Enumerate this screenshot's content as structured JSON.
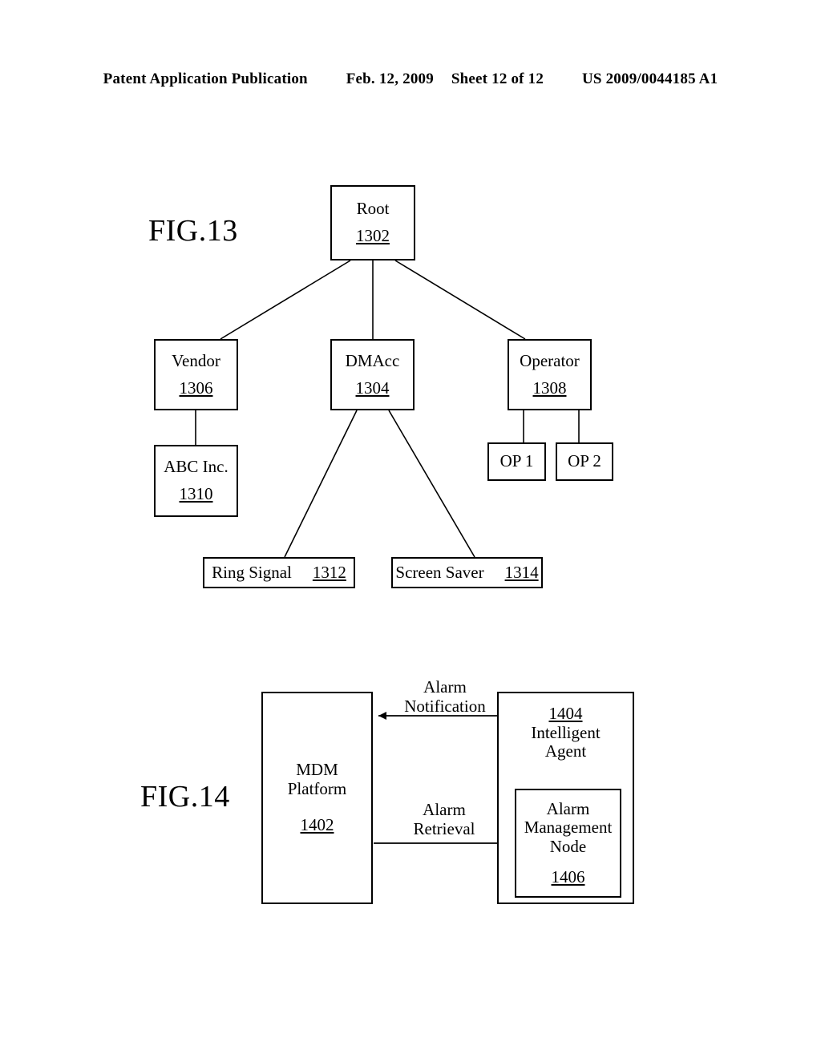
{
  "header": {
    "publication": "Patent Application Publication",
    "date": "Feb. 12, 2009",
    "sheet": "Sheet 12 of 12",
    "number": "US 2009/0044185 A1"
  },
  "fig13": {
    "label": "FIG.13",
    "nodes": {
      "root": {
        "title": "Root",
        "ref": "1302"
      },
      "vendor": {
        "title": "Vendor",
        "ref": "1306"
      },
      "dmacc": {
        "title": "DMAcc",
        "ref": "1304"
      },
      "operator": {
        "title": "Operator",
        "ref": "1308"
      },
      "abc": {
        "title": "ABC Inc.",
        "ref": "1310"
      },
      "op1": {
        "title": "OP 1",
        "ref": ""
      },
      "op2": {
        "title": "OP 2",
        "ref": ""
      },
      "ring_signal": {
        "title": "Ring Signal",
        "ref": "1312"
      },
      "screen_saver": {
        "title": "Screen Saver",
        "ref": "1314"
      }
    }
  },
  "fig14": {
    "label": "FIG.14",
    "nodes": {
      "mdm": {
        "title": "MDM Platform",
        "ref": "1402"
      },
      "agent": {
        "title": "Intelligent Agent",
        "ref": "1404"
      },
      "alarm": {
        "title": "Alarm Management Node",
        "ref": "1406"
      }
    },
    "flows": {
      "notification": "Alarm\nNotification",
      "retrieval": "Alarm\nRetrieval"
    }
  },
  "diagram_data": {
    "type": "diagram",
    "figures": [
      {
        "id": "FIG.13",
        "kind": "tree",
        "nodes": [
          {
            "id": "1302",
            "label": "Root"
          },
          {
            "id": "1304",
            "label": "DMAcc"
          },
          {
            "id": "1306",
            "label": "Vendor"
          },
          {
            "id": "1308",
            "label": "Operator"
          },
          {
            "id": "1310",
            "label": "ABC Inc."
          },
          {
            "id": "op1",
            "label": "OP 1"
          },
          {
            "id": "op2",
            "label": "OP 2"
          },
          {
            "id": "1312",
            "label": "Ring Signal"
          },
          {
            "id": "1314",
            "label": "Screen Saver"
          }
        ],
        "edges": [
          {
            "from": "1302",
            "to": "1306"
          },
          {
            "from": "1302",
            "to": "1304"
          },
          {
            "from": "1302",
            "to": "1308"
          },
          {
            "from": "1306",
            "to": "1310"
          },
          {
            "from": "1308",
            "to": "op1"
          },
          {
            "from": "1308",
            "to": "op2"
          },
          {
            "from": "1304",
            "to": "1312"
          },
          {
            "from": "1304",
            "to": "1314"
          }
        ]
      },
      {
        "id": "FIG.14",
        "kind": "block-flow",
        "nodes": [
          {
            "id": "1402",
            "label": "MDM Platform"
          },
          {
            "id": "1404",
            "label": "Intelligent Agent"
          },
          {
            "id": "1406",
            "label": "Alarm Management Node",
            "parent": "1404"
          }
        ],
        "edges": [
          {
            "from": "1404",
            "to": "1402",
            "label": "Alarm Notification",
            "direction": "left"
          },
          {
            "from": "1402",
            "to": "1406",
            "label": "Alarm Retrieval",
            "direction": "right"
          }
        ]
      }
    ]
  }
}
